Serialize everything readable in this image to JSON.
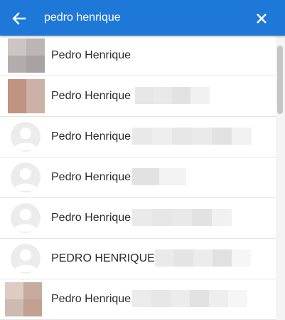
{
  "search": {
    "value": "pedro henrique",
    "back_icon": "arrow-left-icon",
    "clear_icon": "close-icon",
    "bar_color": "#1e78d7"
  },
  "results": [
    {
      "name": "Pedro Henrique",
      "avatar": "photo",
      "colors": [
        "#cbc5c4",
        "#bbb6b5",
        "#b2adac",
        "#a7a3a2"
      ]
    },
    {
      "name": "Pedro Henrique",
      "avatar": "photo",
      "colors": [
        "#c19381",
        "#cdb0a6",
        "#c19381",
        "#cdb0a6"
      ]
    },
    {
      "name": "Pedro Henrique",
      "avatar": "default"
    },
    {
      "name": "Pedro Henrique",
      "avatar": "default"
    },
    {
      "name": "Pedro Henrique",
      "avatar": "default"
    },
    {
      "name": "PEDRO HENRIQUE",
      "avatar": "default"
    },
    {
      "name": "Pedro Henrique",
      "avatar": "photo",
      "colors": [
        "#dcccc4",
        "#c8ab9f",
        "#cdbab1",
        "#c2a192"
      ]
    }
  ]
}
